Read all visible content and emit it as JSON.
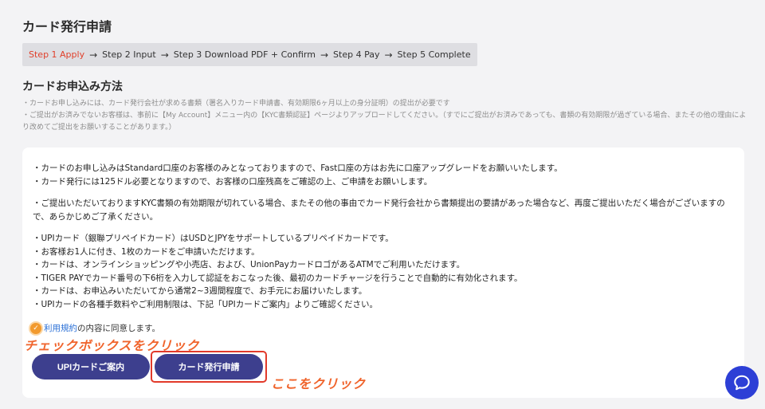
{
  "page": {
    "title": "カード発行申請"
  },
  "steps": [
    {
      "label": "Step 1 Apply",
      "active": true
    },
    {
      "label": "Step 2 Input",
      "active": false
    },
    {
      "label": "Step 3 Download PDF + Confirm",
      "active": false
    },
    {
      "label": "Step 4 Pay",
      "active": false
    },
    {
      "label": "Step 5 Complete",
      "active": false
    }
  ],
  "steps_arrow": "→",
  "section": {
    "title": "カードお申込み方法",
    "notes": [
      "・カードお申し込みには、カード発行会社が求める書類（署名入りカード申請書、有効期限6ヶ月以上の身分証明）の提出が必要です",
      "・ご提出がお済みでないお客様は、事前に【My Account】メニュー内の【KYC書類認証】ページよりアップロードしてください。（すでにご提出がお済みであっても、書類の有効期限が過ぎている場合、またその他の理由により改めてご提出をお願いすることがあります。）"
    ]
  },
  "card": {
    "para1": [
      "・カードのお申し込みはStandard口座のお客様のみとなっておりますので、Fast口座の方はお先に口座アップグレードをお願いいたします。",
      "・カード発行には125ドル必要となりますので、お客様の口座残高をご確認の上、ご申請をお願いします。"
    ],
    "para2": "・ご提出いただいておりますKYC書類の有効期限が切れている場合、またその他の事由でカード発行会社から書類提出の要請があった場合など、再度ご提出いただく場合がございますので、あらかじめご了承ください。",
    "para3": [
      "・UPIカード（銀聯プリペイドカード）はUSDとJPYをサポートしているプリペイドカードです。",
      "・お客様お1人に付き、1枚のカードをご申請いただけます。",
      "・カードは、オンラインショッピングや小売店、および、UnionPayカードロゴがあるATMでご利用いただけます。",
      "・TIGER PAYでカード番号の下6桁を入力して認証をおこなった後、最初のカードチャージを行うことで自動的に有効化されます。",
      "・カードは、お申込みいただいてから通常2~3週間程度で、お手元にお届けいたします。",
      "・UPIカードの各種手数料やご利用制限は、下記「UPIカードご案内」よりご確認ください。"
    ],
    "agree": {
      "link": "利用規約",
      "text": "の内容に同意します。",
      "checked": true
    },
    "buttons": {
      "upi_guide": "UPIカードご案内",
      "issue": "カード発行申請"
    }
  },
  "annotations": {
    "checkbox_hint": "チェックボックスをクリック",
    "click_here": "ここをクリック"
  },
  "colors": {
    "active_step": "#e0402b",
    "button": "#3d3f8e",
    "highlight": "#e23a2a",
    "annotation": "#f0642c",
    "checkbox": "#f29a2e",
    "chat": "#2d3fd6"
  },
  "icons": {
    "checkbox": "check-icon",
    "chat": "chat-bubble-icon"
  }
}
